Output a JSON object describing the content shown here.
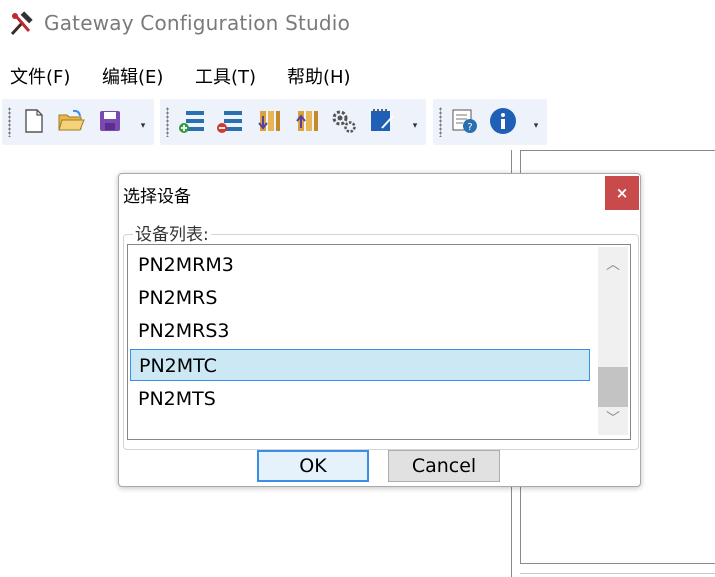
{
  "app": {
    "title": "Gateway Configuration Studio",
    "icon": "hammer-wrench-icon"
  },
  "menu": [
    "文件(F)",
    "编辑(E)",
    "工具(T)",
    "帮助(H)"
  ],
  "toolbars": [
    {
      "buttons": [
        "new-file-icon",
        "open-folder-icon",
        "save-icon"
      ]
    },
    {
      "buttons": [
        "add-device-icon",
        "remove-device-icon",
        "download-icon",
        "upload-icon",
        "settings-gears-icon",
        "edit-notes-icon"
      ]
    },
    {
      "buttons": [
        "help-context-icon",
        "info-icon"
      ]
    }
  ],
  "dialog": {
    "title": "选择设备",
    "close": "×",
    "group_label": "设备列表:",
    "items": [
      "PN2MRM3",
      "PN2MRS",
      "PN2MRS3",
      "PN2MTC",
      "PN2MTS"
    ],
    "selected_index": 3,
    "ok": "OK",
    "cancel": "Cancel"
  },
  "colors": {
    "toolbar_bg": "#eef3fb",
    "selection": "#cce8f4",
    "close_button": "#c94a4a"
  }
}
